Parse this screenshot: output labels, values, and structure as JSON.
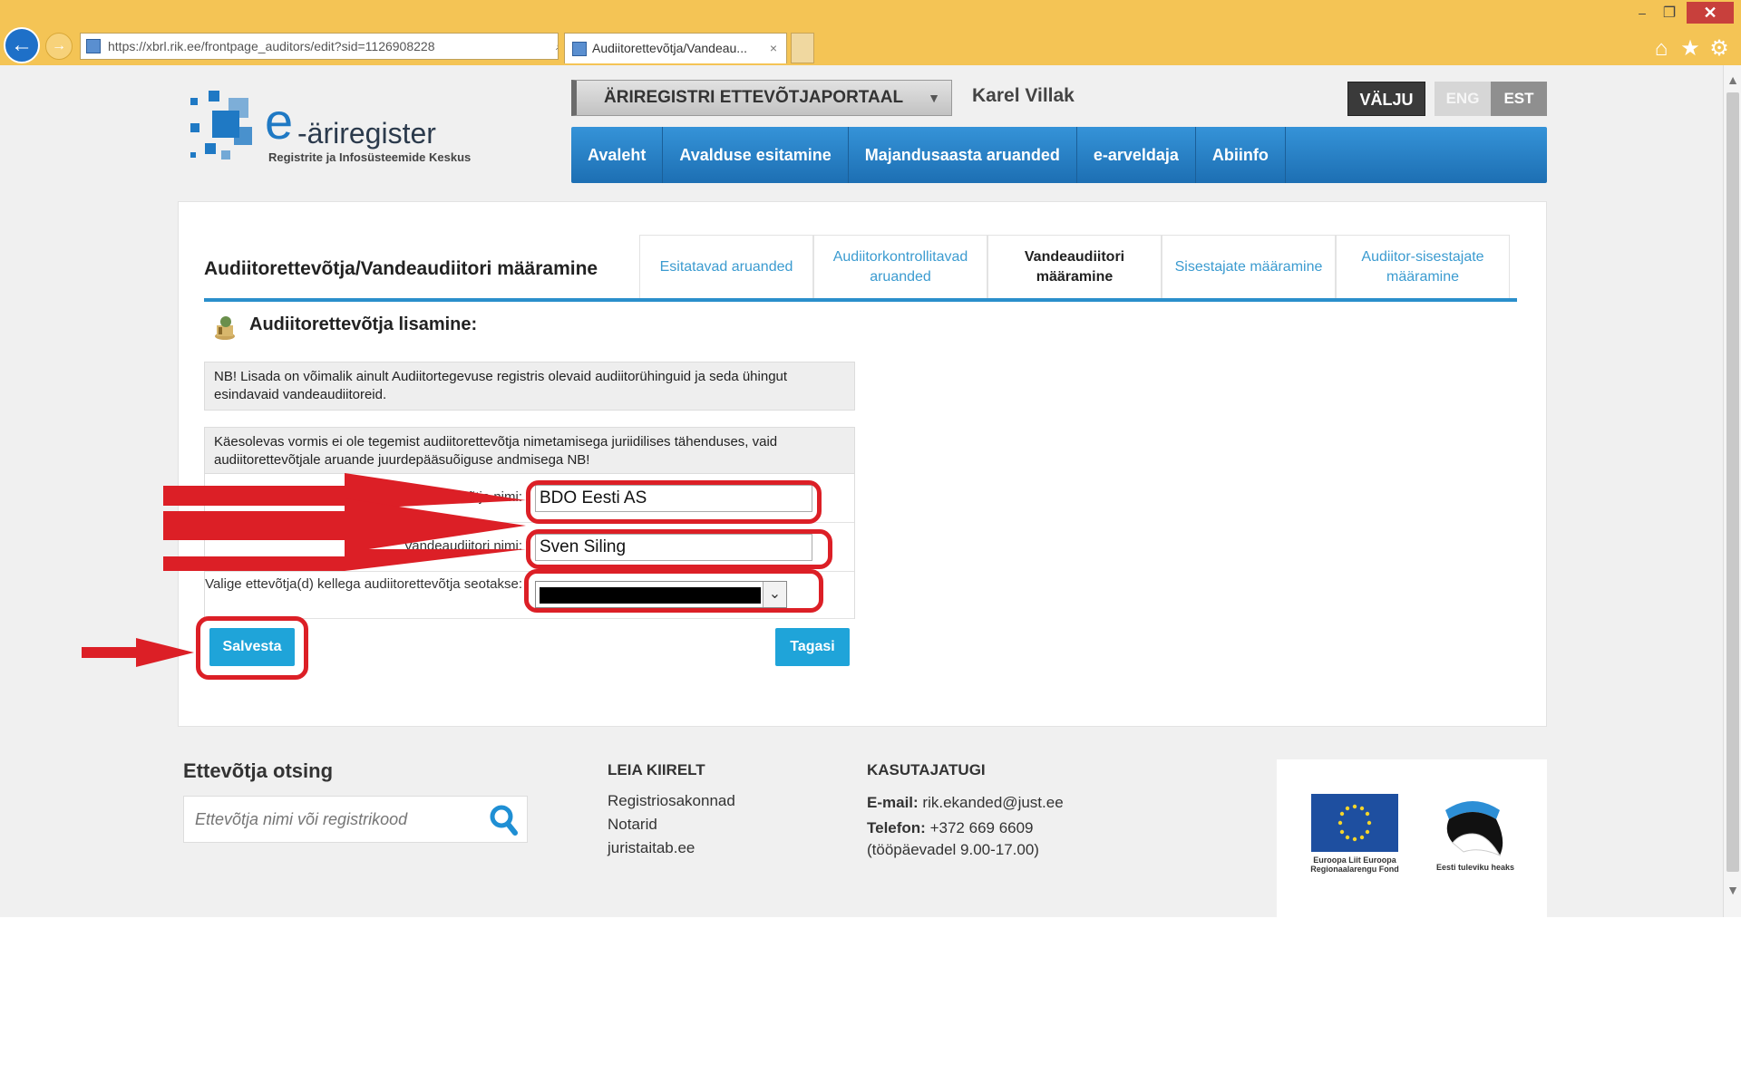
{
  "browser": {
    "url": "https://xbrl.rik.ee/frontpage_auditors/edit?sid=1126908228",
    "tab_title": "Audiitorettevõtja/Vandeau...",
    "tab_close": "×",
    "win_minimize": "–",
    "win_maximize": "❐",
    "win_close": "✕"
  },
  "logo": {
    "e": "e",
    "name": "-äriregister",
    "subtitle": "Registrite ja Infosüsteemide Keskus"
  },
  "header": {
    "portal": "ÄRIREGISTRI ETTEVÕTJAPORTAAL",
    "user": "Karel Villak",
    "logout": "VÄLJU",
    "lang_eng": "ENG",
    "lang_est": "EST"
  },
  "nav": {
    "items": [
      {
        "label": "Avaleht"
      },
      {
        "label": "Avalduse esitamine"
      },
      {
        "label": "Majandusaasta aruanded"
      },
      {
        "label": "e-arveldaja"
      },
      {
        "label": "Abiinfo"
      }
    ]
  },
  "content": {
    "title": "Audiitorettevõtja/Vandeaudiitori määramine",
    "tabs": [
      {
        "label": "Esitatavad aruanded"
      },
      {
        "label": "Audiitorkontrollitavad aruanded"
      },
      {
        "label": "Vandeaudiitori määramine"
      },
      {
        "label": "Sisestajate määramine"
      },
      {
        "label": "Audiitor-sisestajate määramine"
      }
    ],
    "section_title": "Audiitorettevõtja lisamine:",
    "note1": "NB! Lisada on võimalik ainult Audiitortegevuse registris olevaid audiitorühinguid ja seda ühingut esindavaid vandeaudiitoreid.",
    "note2": "Käesolevas vormis ei ole tegemist audiitorettevõtja nimetamisega juriidilises tähenduses, vaid audiitorettevõtjale aruande juurdepääsuõiguse andmisega NB!",
    "form": {
      "company_label": "Audiitorettevõtja nimi:",
      "company_value": "BDO Eesti AS",
      "auditor_label": "Vandeaudiitori nimi:",
      "auditor_value": "Sven Siling",
      "select_label": "Valige ettevõtja(d) kellega audiitorettevõtja seotakse:"
    },
    "save": "Salvesta",
    "back": "Tagasi"
  },
  "footer": {
    "search_title": "Ettevõtja otsing",
    "search_placeholder": "Ettevõtja nimi või registrikood",
    "quick_title": "LEIA KIIRELT",
    "quick_links": [
      {
        "label": "Registriosakonnad"
      },
      {
        "label": "Notarid"
      },
      {
        "label": "juristaitab.ee"
      }
    ],
    "support_title": "KASUTAJATUGI",
    "email_label": "E-mail:",
    "email": "rik.ekanded@just.ee",
    "phone_label": "Telefon:",
    "phone": "+372 669 6609",
    "hours": "(tööpäevadel 9.00-17.00)",
    "eu_caption": "Euroopa Liit Euroopa Regionaalarengu Fond",
    "ee_caption": "Eesti tuleviku heaks"
  },
  "colors": {
    "accent_blue": "#1f79c4",
    "button_blue": "#1fa4d9",
    "annotation_red": "#dc1f26"
  }
}
